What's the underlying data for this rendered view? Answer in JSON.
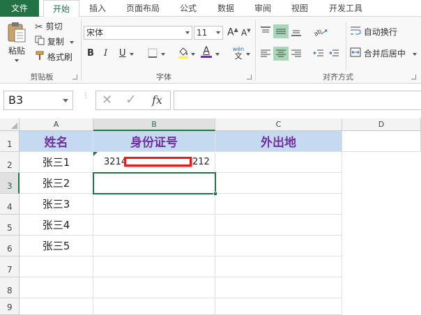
{
  "ribbon_tabs": [
    "文件",
    "开始",
    "插入",
    "页面布局",
    "公式",
    "数据",
    "审阅",
    "视图",
    "开发工具"
  ],
  "clipboard": {
    "paste": "粘贴",
    "cut": "剪切",
    "copy": "复制",
    "format_painter": "格式刷",
    "group_label": "剪贴板"
  },
  "font": {
    "name": "宋体",
    "size": "11",
    "bold": "B",
    "italic": "I",
    "underline": "U",
    "font_color_glyph": "A",
    "wen_glyph": "wén",
    "wen_sub": "文",
    "grow": "A",
    "shrink": "A",
    "group_label": "字体"
  },
  "alignment": {
    "wrap_text": "自动换行",
    "merge_center": "合并后居中",
    "group_label": "对齐方式"
  },
  "formula_bar": {
    "name_box": "B3",
    "cancel_glyph": "✕",
    "enter_glyph": "✓",
    "fx": "fx",
    "value": ""
  },
  "columns": [
    "A",
    "B",
    "C",
    "D"
  ],
  "rows": [
    "1",
    "2",
    "3",
    "4",
    "5",
    "6",
    "7",
    "8",
    "9"
  ],
  "table": {
    "headers": [
      "姓名",
      "身份证号",
      "外出地"
    ],
    "names": [
      "张三1",
      "张三2",
      "张三3",
      "张三4",
      "张三5"
    ],
    "id_prefix": "3214",
    "id_suffix": "212"
  },
  "colors": {
    "excel_green": "#217346",
    "header_fill": "#c5d9f1",
    "header_text": "#7030a0",
    "redaction_border": "#e02020"
  }
}
